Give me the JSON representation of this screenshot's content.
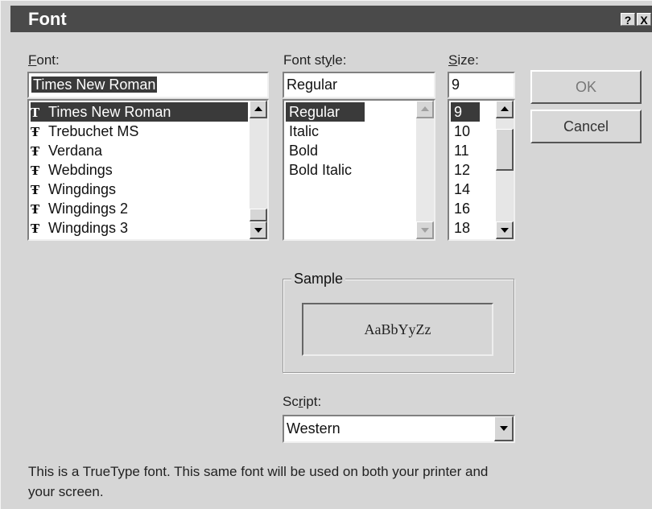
{
  "window": {
    "title": "Font",
    "help_label": "?",
    "close_label": "X"
  },
  "labels": {
    "font": {
      "pre": "",
      "key": "F",
      "post": "ont:"
    },
    "font_style": {
      "pre": "Font st",
      "key": "y",
      "post": "le:"
    },
    "size": {
      "pre": "",
      "key": "S",
      "post": "ize:"
    },
    "script": {
      "pre": "Sc",
      "key": "r",
      "post": "ipt:"
    }
  },
  "font": {
    "value": "Times New Roman",
    "items": [
      {
        "icon": "T",
        "label": "Times New Roman",
        "selected": true
      },
      {
        "icon": "TT",
        "label": "Trebuchet MS",
        "selected": false
      },
      {
        "icon": "TT",
        "label": "Verdana",
        "selected": false
      },
      {
        "icon": "TT",
        "label": "Webdings",
        "selected": false
      },
      {
        "icon": "TT",
        "label": "Wingdings",
        "selected": false
      },
      {
        "icon": "TT",
        "label": "Wingdings 2",
        "selected": false
      },
      {
        "icon": "TT",
        "label": "Wingdings 3",
        "selected": false
      }
    ]
  },
  "style": {
    "value": "Regular",
    "items": [
      "Regular",
      "Italic",
      "Bold",
      "Bold Italic"
    ]
  },
  "size": {
    "value": "9",
    "items": [
      "9",
      "10",
      "11",
      "12",
      "14",
      "16",
      "18"
    ]
  },
  "buttons": {
    "ok": "OK",
    "cancel": "Cancel"
  },
  "sample": {
    "title": "Sample",
    "text": "AaBbYyZz"
  },
  "script": {
    "value": "Western"
  },
  "description": "This is a TrueType font. This same font will be used on both your printer and your screen."
}
